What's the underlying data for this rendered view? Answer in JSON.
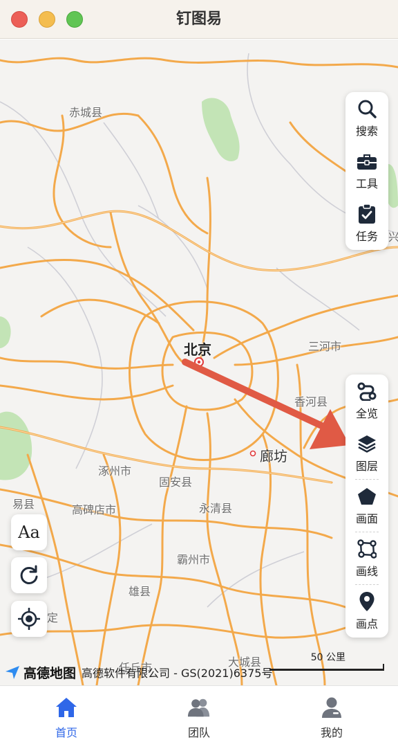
{
  "window": {
    "title": "钉图易"
  },
  "colors": {
    "accent": "#2f67e8",
    "road": "#f3a94b",
    "arrow": "#e05a45",
    "green": "#bfe3b1"
  },
  "map": {
    "labels": {
      "chicheng": "赤城县",
      "beijing": "北京",
      "sanhe": "三河市",
      "xianghe": "香河县",
      "langfang": "廊坊",
      "zhuozhou": "涿州市",
      "guan": "固安县",
      "yixian": "易县",
      "gaobeidian": "高碑店市",
      "yongqing": "永清县",
      "bazhou": "霸州市",
      "xiongxian": "雄县",
      "ding": "定",
      "renqiu": "任丘市",
      "daicheng": "大城县",
      "xing": "兴"
    },
    "attribution": {
      "brand": "高德地图",
      "text": "高德软件有限公司 - GS(2021)6375号"
    },
    "scale": {
      "text": "50 公里"
    }
  },
  "toolbar_top": [
    {
      "label": "搜索",
      "icon": "search-icon"
    },
    {
      "label": "工具",
      "icon": "toolbox-icon"
    },
    {
      "label": "任务",
      "icon": "clipboard-check-icon"
    }
  ],
  "toolbar_bottom": [
    {
      "label": "全览",
      "icon": "route-icon"
    },
    {
      "label": "图层",
      "icon": "layers-icon"
    },
    {
      "label": "画面",
      "icon": "pentagon-icon"
    },
    {
      "label": "画线",
      "icon": "polyline-icon"
    },
    {
      "label": "画点",
      "icon": "map-pin-icon"
    }
  ],
  "left_buttons": {
    "font_label": "Aa"
  },
  "bottom_nav": [
    {
      "label": "首页",
      "icon": "home-icon",
      "active": true
    },
    {
      "label": "团队",
      "icon": "team-icon",
      "active": false
    },
    {
      "label": "我的",
      "icon": "user-icon",
      "active": false
    }
  ]
}
